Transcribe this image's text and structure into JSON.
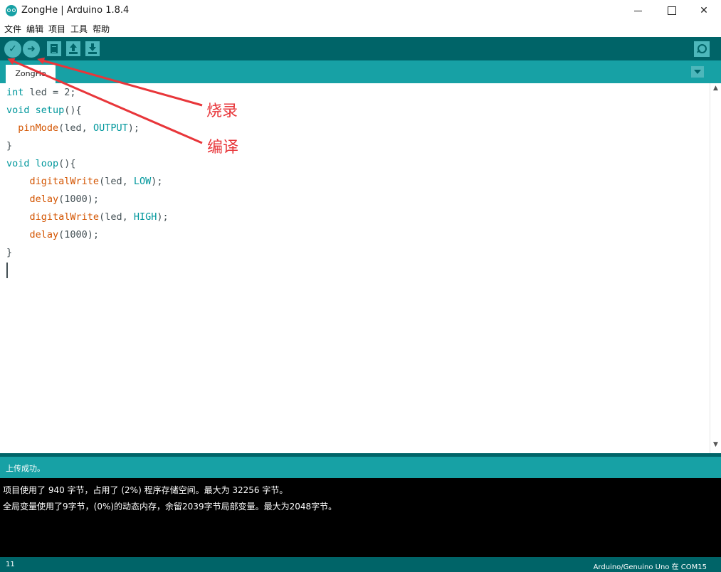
{
  "window": {
    "title": "ZongHe | Arduino 1.8.4",
    "minimize": "",
    "maximize": "",
    "close": "✕"
  },
  "menu": [
    "文件",
    "编辑",
    "项目",
    "工具",
    "帮助"
  ],
  "toolbar": {
    "verify_glyph": "✓",
    "upload_glyph": "➜"
  },
  "tab": {
    "label": "ZongHe"
  },
  "code": [
    [
      {
        "t": "int",
        "c": "kw"
      },
      {
        "t": " led = 2;",
        "c": ""
      }
    ],
    [
      {
        "t": "void",
        "c": "kw"
      },
      {
        "t": " ",
        "c": ""
      },
      {
        "t": "setup",
        "c": "kw"
      },
      {
        "t": "(){",
        "c": ""
      }
    ],
    [
      {
        "t": "  ",
        "c": ""
      },
      {
        "t": "pinMode",
        "c": "fn"
      },
      {
        "t": "(led, ",
        "c": ""
      },
      {
        "t": "OUTPUT",
        "c": "kw"
      },
      {
        "t": ");",
        "c": ""
      }
    ],
    [
      {
        "t": "}",
        "c": ""
      }
    ],
    [
      {
        "t": "void",
        "c": "kw"
      },
      {
        "t": " ",
        "c": ""
      },
      {
        "t": "loop",
        "c": "kw"
      },
      {
        "t": "(){",
        "c": ""
      }
    ],
    [
      {
        "t": "    ",
        "c": ""
      },
      {
        "t": "digitalWrite",
        "c": "fn"
      },
      {
        "t": "(led, ",
        "c": ""
      },
      {
        "t": "LOW",
        "c": "kw"
      },
      {
        "t": ");",
        "c": ""
      }
    ],
    [
      {
        "t": "    ",
        "c": ""
      },
      {
        "t": "delay",
        "c": "fn"
      },
      {
        "t": "(1000);",
        "c": ""
      }
    ],
    [
      {
        "t": "    ",
        "c": ""
      },
      {
        "t": "digitalWrite",
        "c": "fn"
      },
      {
        "t": "(led, ",
        "c": ""
      },
      {
        "t": "HIGH",
        "c": "kw"
      },
      {
        "t": ");",
        "c": ""
      }
    ],
    [
      {
        "t": "    ",
        "c": ""
      },
      {
        "t": "delay",
        "c": "fn"
      },
      {
        "t": "(1000);",
        "c": ""
      }
    ],
    [
      {
        "t": "}",
        "c": ""
      }
    ]
  ],
  "annotations": {
    "burn_label": "烧录",
    "compile_label": "编译",
    "color": "#e8363a"
  },
  "console": {
    "status": "上传成功。",
    "lines": [
      "项目使用了 940 字节，占用了 (2%) 程序存储空间。最大为 32256 字节。",
      "全局变量使用了9字节，(0%)的动态内存，余留2039字节局部变量。最大为2048字节。"
    ]
  },
  "statusbar": {
    "line": "11",
    "board": "Arduino/Genuino Uno 在 COM15"
  },
  "colors": {
    "toolbar": "#006468",
    "tabstrip": "#17a1a5",
    "button": "#4db7bb",
    "keyword": "#00979c",
    "function": "#d35400"
  }
}
